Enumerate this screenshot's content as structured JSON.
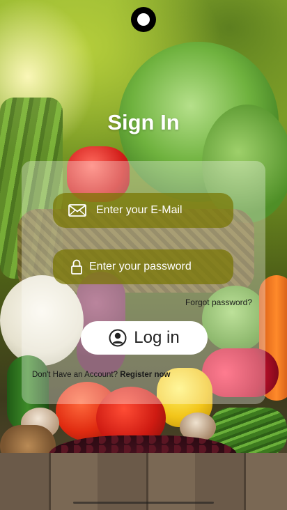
{
  "screen": {
    "title": "Sign In"
  },
  "form": {
    "email_placeholder": "Enter your E-Mail",
    "email_value": "",
    "password_placeholder": "Enter your password",
    "password_value": "",
    "forgot_password": "Forgot password?",
    "login_label": "Log in",
    "no_account_text": "Don't Have an Account?",
    "register_link": "Register now"
  },
  "icons": {
    "email": "envelope-icon",
    "password": "lock-icon",
    "login": "user-circle-icon"
  },
  "colors": {
    "field_background": "#787600",
    "button_background": "#ffffff",
    "title_text": "#ffffff"
  }
}
